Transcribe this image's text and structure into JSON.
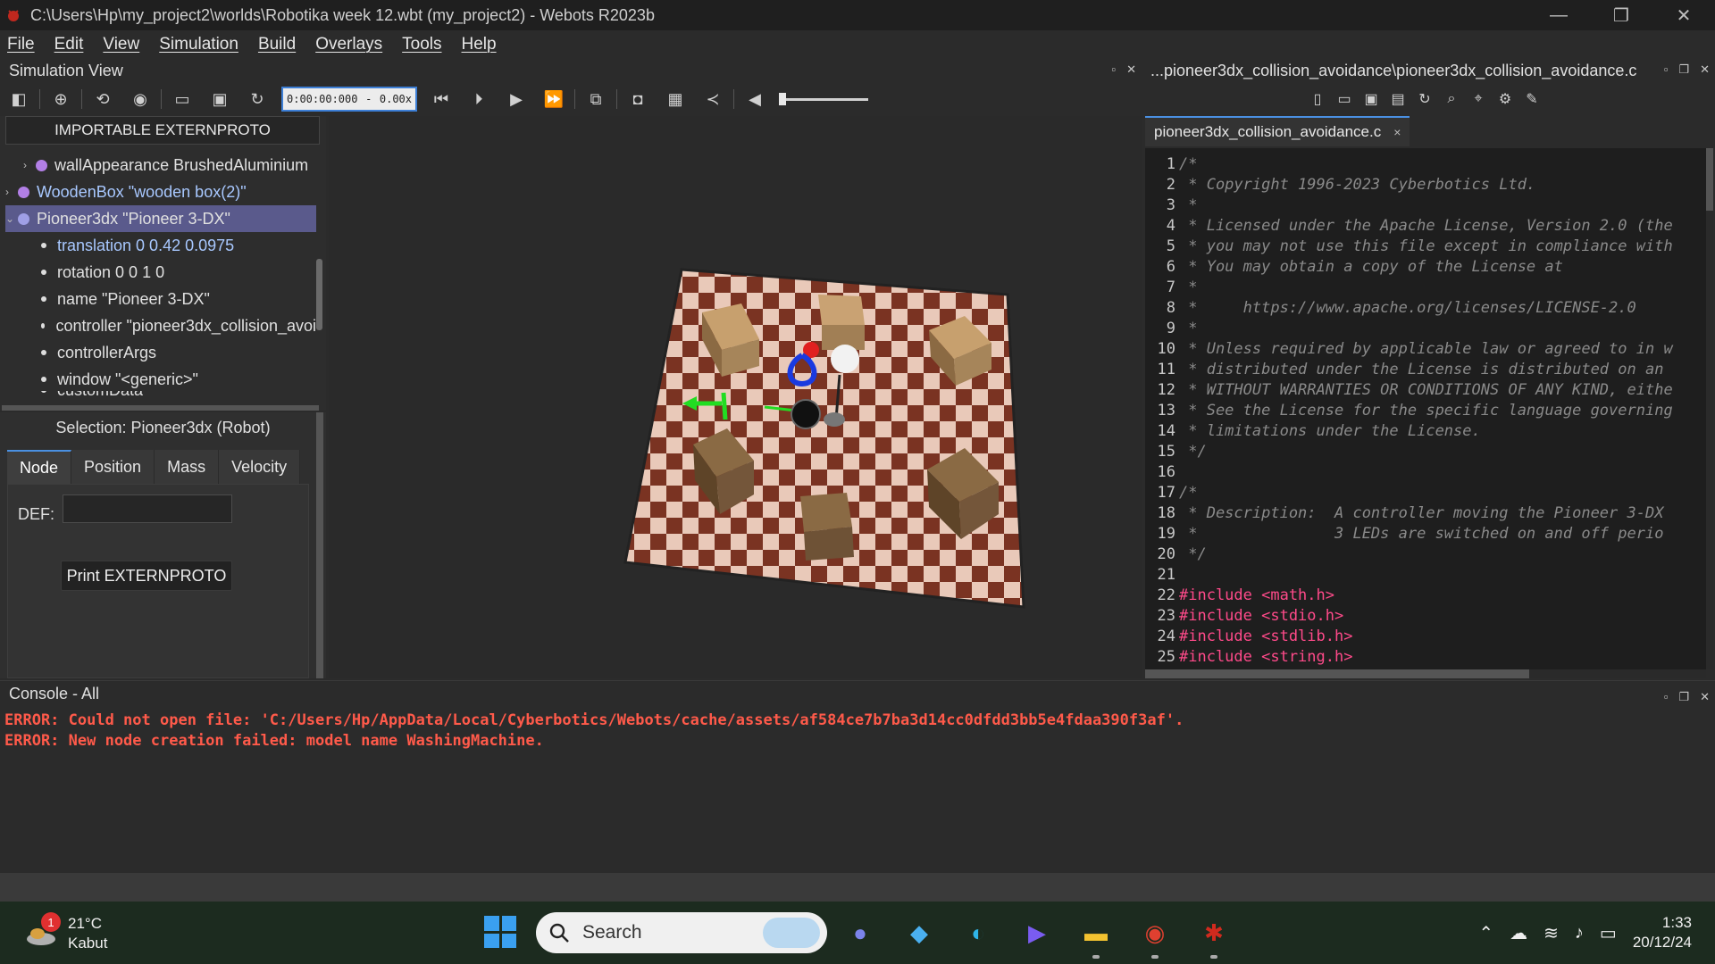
{
  "window": {
    "title": "C:\\Users\\Hp\\my_project2\\worlds\\Robotika week 12.wbt (my_project2) - Webots R2023b",
    "controls": [
      "—",
      "❐",
      "✕"
    ]
  },
  "menu": [
    "File",
    "Edit",
    "View",
    "Simulation",
    "Build",
    "Overlays",
    "Tools",
    "Help"
  ],
  "simulation_view": {
    "title": "Simulation View",
    "time": "0:00:00:000",
    "speed": "0.00x",
    "speed_dash": "-"
  },
  "scene_tree": {
    "header": "IMPORTABLE EXTERNPROTO",
    "nodes": [
      {
        "label": "wallAppearance BrushedAluminium",
        "arrow": "›"
      },
      {
        "label": "WoodenBox \"wooden box(2)\"",
        "arrow": "›"
      },
      {
        "label": "Pioneer3dx \"Pioneer 3-DX\"",
        "arrow": "⌄"
      }
    ],
    "fields": [
      "translation 0 0.42 0.0975",
      "rotation 0 0 1 0",
      "name \"Pioneer 3-DX\"",
      "controller \"pioneer3dx_collision_avoi",
      "controllerArgs",
      "window \"<generic>\"",
      "customData \"\""
    ]
  },
  "selection": {
    "title": "Selection: Pioneer3dx (Robot)",
    "tabs": [
      "Node",
      "Position",
      "Mass",
      "Velocity"
    ],
    "def_label": "DEF:",
    "def_value": "",
    "print_button": "Print EXTERNPROTO"
  },
  "editor": {
    "title": "...pioneer3dx_collision_avoidance\\pioneer3dx_collision_avoidance.c",
    "tab": "pioneer3dx_collision_avoidance.c",
    "tab_close": "×",
    "lines": [
      "/*",
      " * Copyright 1996-2023 Cyberbotics Ltd.",
      " *",
      " * Licensed under the Apache License, Version 2.0 (the",
      " * you may not use this file except in compliance with",
      " * You may obtain a copy of the License at",
      " *",
      " *     https://www.apache.org/licenses/LICENSE-2.0",
      " *",
      " * Unless required by applicable law or agreed to in w",
      " * distributed under the License is distributed on an",
      " * WITHOUT WARRANTIES OR CONDITIONS OF ANY KIND, eithe",
      " * See the License for the specific language governing",
      " * limitations under the License.",
      " */",
      "",
      "/*",
      " * Description:  A controller moving the Pioneer 3-DX",
      " *               3 LEDs are switched on and off perio",
      " */",
      "",
      "#include <math.h>",
      "#include <stdio.h>",
      "#include <stdlib.h>",
      "#include <string.h>"
    ]
  },
  "console": {
    "title": "Console - All",
    "lines": [
      "ERROR: Could not open file: 'C:/Users/Hp/AppData/Local/Cyberbotics/Webots/cache/assets/af584ce7b7ba3d14cc0dfdd3bb5e4fdaa390f3af'.",
      "ERROR: New node creation failed: model name WashingMachine."
    ],
    "error_color": "#ff5a4a"
  },
  "taskbar": {
    "weather_temp": "21°C",
    "weather_desc": "Kabut",
    "weather_badge": "1",
    "search_placeholder": "Search",
    "time": "1:33",
    "date": "20/12/24"
  },
  "colors": {
    "accent": "#4a90e2",
    "selected_row": "#5a5a8c",
    "node_dot": "#b27fe6"
  }
}
